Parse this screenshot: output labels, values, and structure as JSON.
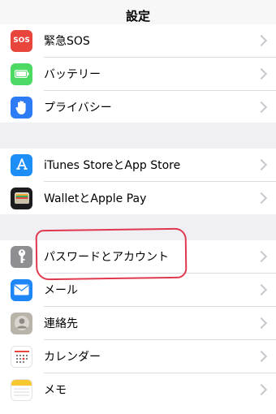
{
  "header": {
    "title": "設定"
  },
  "groups": [
    {
      "items": [
        {
          "label": "緊急SOS",
          "icon": "sos-icon",
          "icon_text": "SOS",
          "color": "#e8453c"
        },
        {
          "label": "バッテリー",
          "icon": "battery-icon",
          "color": "#4cd964"
        },
        {
          "label": "プライバシー",
          "icon": "privacy-hand-icon",
          "color": "#2d7cf6"
        }
      ]
    },
    {
      "items": [
        {
          "label": "iTunes StoreとApp Store",
          "icon": "app-store-icon",
          "color": "#1e8ef7"
        },
        {
          "label": "WalletとApple Pay",
          "icon": "wallet-icon",
          "color": "#1c1c1e"
        }
      ]
    },
    {
      "items": [
        {
          "label": "パスワードとアカウント",
          "icon": "key-icon",
          "color": "#8e8e93"
        },
        {
          "label": "メール",
          "icon": "mail-icon",
          "color": "#1f86f7"
        },
        {
          "label": "連絡先",
          "icon": "contacts-icon",
          "color": "#b8b4aa"
        },
        {
          "label": "カレンダー",
          "icon": "calendar-icon",
          "color": "#ffffff"
        },
        {
          "label": "メモ",
          "icon": "notes-icon",
          "color": "#ffffff"
        }
      ]
    }
  ],
  "annotation": {
    "color": "#e0394f"
  }
}
